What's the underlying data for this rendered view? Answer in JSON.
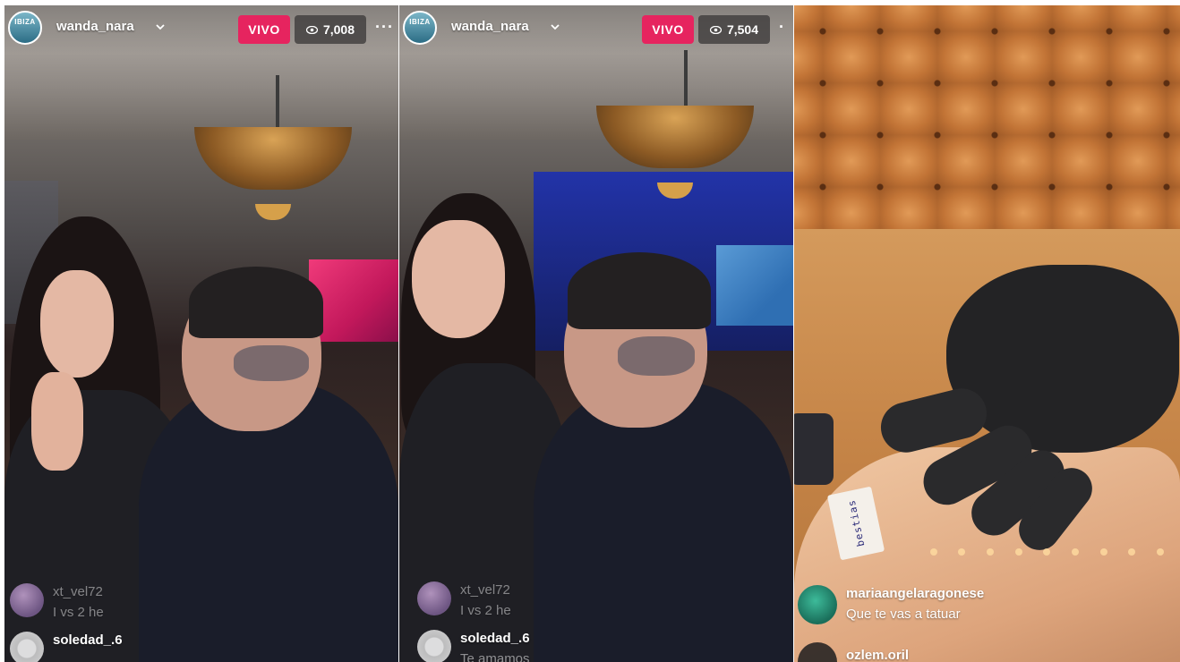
{
  "panels": [
    {
      "username": "wanda_nara",
      "avatar_label": "IBIZA",
      "live_label": "VIVO",
      "viewer_count": "7,008",
      "comments": [
        {
          "user": "xt_vel72",
          "message": "I vs 2 he"
        },
        {
          "user": "soledad_.6",
          "message": ""
        }
      ]
    },
    {
      "username": "wanda_nara",
      "avatar_label": "IBIZA",
      "live_label": "VIVO",
      "viewer_count": "7,504",
      "comments": [
        {
          "user": "xt_vel72",
          "message": "I vs 2 he"
        },
        {
          "user": "soledad_.6",
          "message": "Te amamos"
        }
      ]
    },
    {
      "stencil_text": "bestias",
      "comments": [
        {
          "user": "mariaangelaragonese",
          "message": "Que te vas a tatuar"
        },
        {
          "user": "ozlem.oril",
          "message": ""
        }
      ]
    }
  ],
  "colors": {
    "live_badge": "#e6245f",
    "viewer_pill": "#3c3a3a",
    "text": "#ffffff"
  },
  "icons": {
    "viewers": "eye-icon",
    "username_menu": "chevron-down-icon",
    "more": "more-options-icon"
  }
}
